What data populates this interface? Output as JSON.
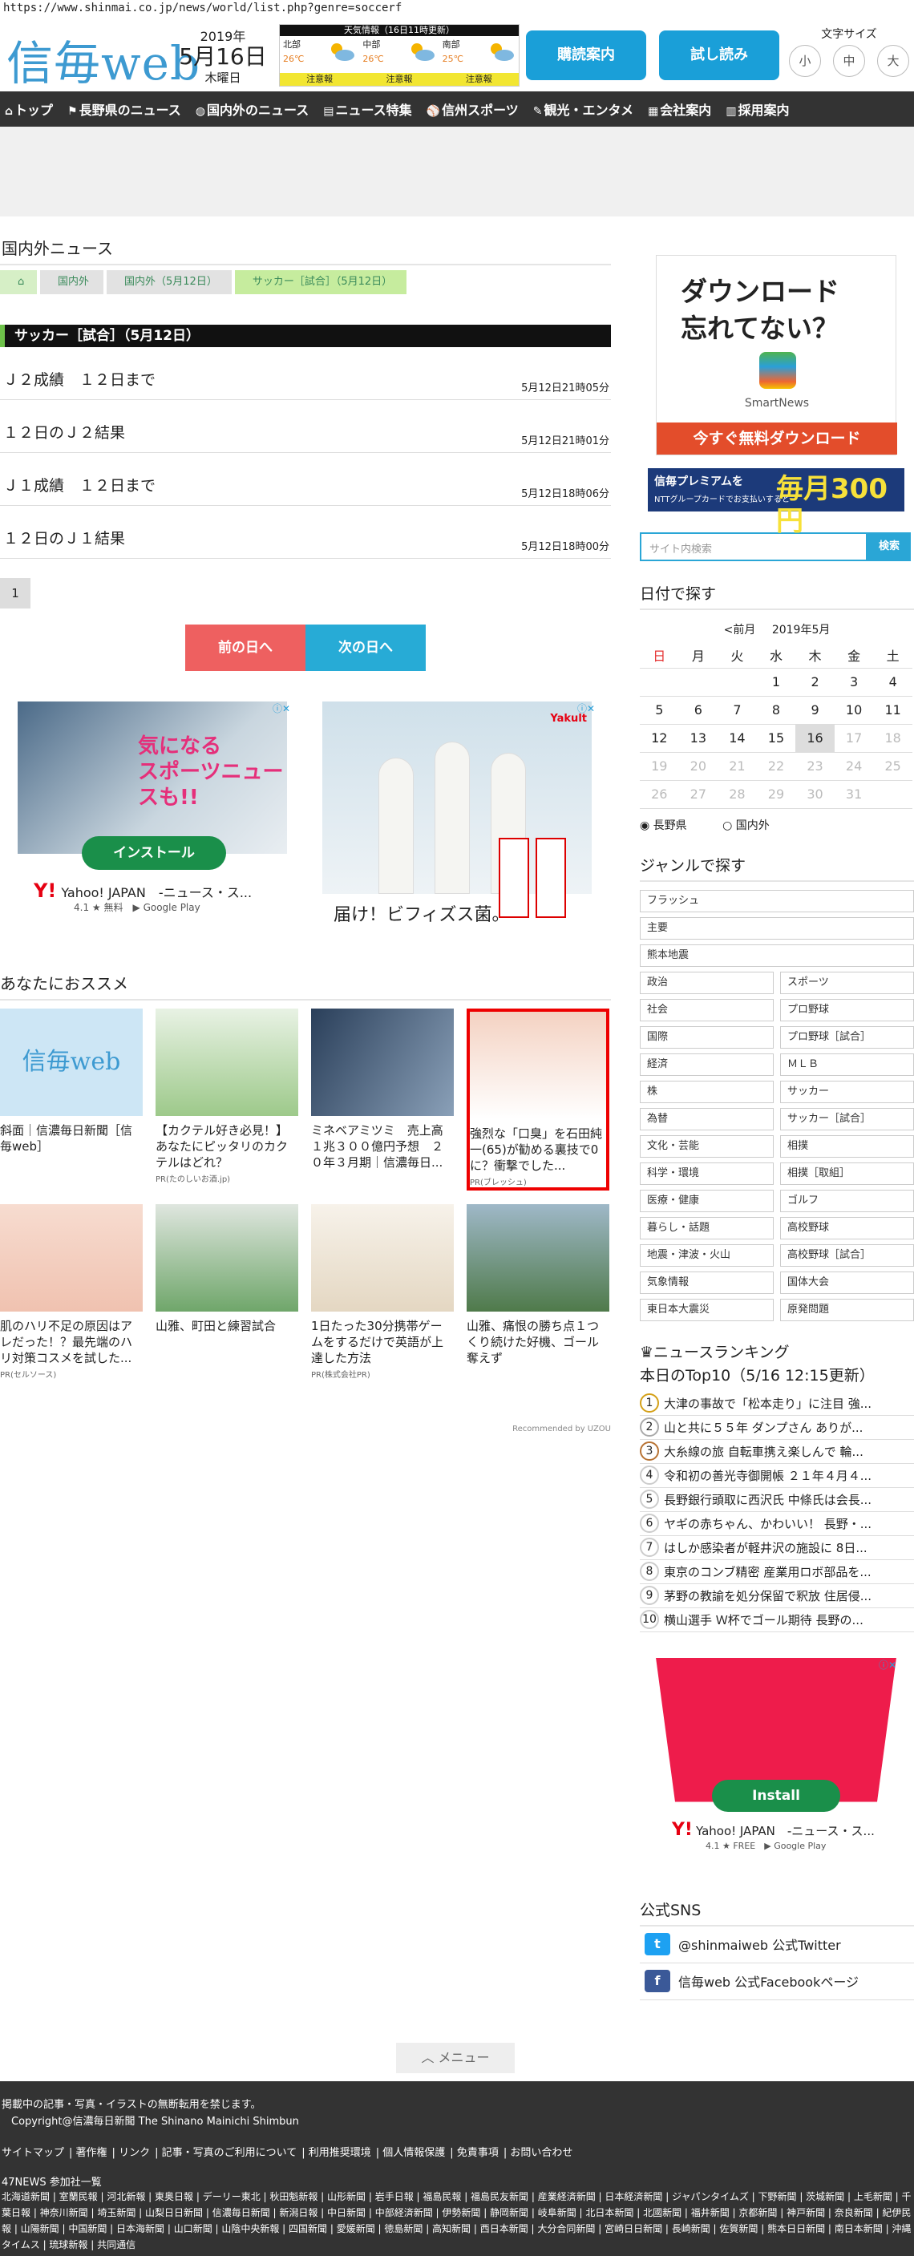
{
  "browser": {
    "url": "https://www.shinmai.co.jp/news/world/list.php?genre=soccerf"
  },
  "header": {
    "logo_text": "信毎web",
    "date": {
      "year": "2019年",
      "month_day": "5月16日",
      "weekday": "木曜日"
    },
    "weather": {
      "title": "天気情報（16日11時更新）",
      "areas": [
        {
          "name": "北部",
          "temp": "26℃",
          "icon": "sun-cloud-icon",
          "warn": "注意報"
        },
        {
          "name": "中部",
          "temp": "26℃",
          "icon": "sun-cloud-icon",
          "warn": "注意報"
        },
        {
          "name": "南部",
          "temp": "25℃",
          "icon": "sun-cloud-icon",
          "warn": "注意報"
        }
      ]
    },
    "subscribe_label": "購読案内",
    "trial_label": "試し読み",
    "font_size": {
      "label": "文字サイズ",
      "small": "小",
      "medium": "中",
      "large": "大"
    }
  },
  "nav": {
    "items": [
      {
        "icon": "home-icon",
        "label": "トップ"
      },
      {
        "icon": "flag-icon",
        "label": "長野県のニュース"
      },
      {
        "icon": "globe-icon",
        "label": "国内外のニュース"
      },
      {
        "icon": "doc-icon",
        "label": "ニュース特集"
      },
      {
        "icon": "sports-icon",
        "label": "信州スポーツ"
      },
      {
        "icon": "camera-icon",
        "label": "観光・エンタメ"
      },
      {
        "icon": "building-icon",
        "label": "会社案内"
      },
      {
        "icon": "people-icon",
        "label": "採用案内"
      }
    ]
  },
  "main": {
    "page_title": "国内外ニュース",
    "breadcrumb": [
      "国内外",
      "国内外（5月12日）",
      "サッカー［試合］（5月12日）"
    ],
    "section_title": "サッカー［試合］（5月12日）",
    "articles": [
      {
        "title": "Ｊ２成績　１２日まで",
        "date": "5月12日21時05分"
      },
      {
        "title": "１２日のＪ２結果",
        "date": "5月12日21時01分"
      },
      {
        "title": "Ｊ１成績　１２日まで",
        "date": "5月12日18時06分"
      },
      {
        "title": "１２日のＪ１結果",
        "date": "5月12日18時00分"
      }
    ],
    "page": "1",
    "prev_day": "前の日へ",
    "next_day": "次の日へ"
  },
  "ads": {
    "ad1": {
      "headline": "気になる\nスポーツニュースも!!",
      "install": "インストール",
      "app": "Yahoo! JAPAN　-ニュース・ス...",
      "rating": "4.1 ★ 無料",
      "store": "Google Play",
      "yj": "Y!"
    },
    "ad2": {
      "brand": "Yakult",
      "text": "届け！ビフィズス菌。"
    },
    "choices": "ⓘ✕"
  },
  "recommend": {
    "title": "あなたにおススメ",
    "cards": [
      {
        "text": "斜面｜信濃毎日新聞［信毎web］",
        "pr": ""
      },
      {
        "text": "【カクテル好き必見！】あなたにピッタリのカクテルはどれ？",
        "pr": "PR(たのしいお酒.jp)"
      },
      {
        "text": "ミネベアミツミ　売上高１兆３００億円予想　２０年３月期｜信濃毎日...",
        "pr": ""
      },
      {
        "text": "強烈な「口臭」を石田純一(65)が勧める裏技で0に？衝撃でした...",
        "pr": "PR(ブレッシュ)"
      },
      {
        "text": "肌のハリ不足の原因はアレだった！？最先端のハリ対策コスメを試した...",
        "pr": "PR(セルソース)"
      },
      {
        "text": "山雅、町田と練習試合",
        "pr": ""
      },
      {
        "text": "1日たった30分携帯ゲームをするだけで英語が上達した方法",
        "pr": "PR(株式会社PR)"
      },
      {
        "text": "山雅、痛恨の勝ち点１つくり続けた好機、ゴール奪えず",
        "pr": ""
      }
    ],
    "by": "Recommended by UZOU"
  },
  "sidebar": {
    "smartnews": {
      "q1": "ダウンロード",
      "q2": "忘れてない？",
      "name": "SmartNews",
      "cta": "今すぐ無料ダウンロード"
    },
    "premium": {
      "a": "信毎プレミアムを",
      "b": "NTTグループカードでお支払いすると",
      "c": "毎月300円"
    },
    "search_placeholder": "サイト内検索",
    "search_button": "検索",
    "date_title": "日付で探す",
    "cal_prev": "<前月",
    "cal_month": "2019年5月",
    "weekdays": [
      "日",
      "月",
      "火",
      "水",
      "木",
      "金",
      "土"
    ],
    "weeks": [
      [
        "",
        "",
        "",
        "1",
        "2",
        "3",
        "4"
      ],
      [
        "5",
        "6",
        "7",
        "8",
        "9",
        "10",
        "11"
      ],
      [
        "12",
        "13",
        "14",
        "15",
        "16",
        "17",
        "18"
      ],
      [
        "19",
        "20",
        "21",
        "22",
        "23",
        "24",
        "25"
      ],
      [
        "26",
        "27",
        "28",
        "29",
        "30",
        "31",
        ""
      ]
    ],
    "radio1": "長野県",
    "radio2": "国内外",
    "genre_title": "ジャンルで探す",
    "genres_full": [
      "フラッシュ",
      "主要",
      "熊本地震"
    ],
    "genres": [
      "政治",
      "スポーツ",
      "社会",
      "プロ野球",
      "国際",
      "プロ野球［試合］",
      "経済",
      "ＭＬＢ",
      "株",
      "サッカー",
      "為替",
      "サッカー［試合］",
      "文化・芸能",
      "相撲",
      "科学・環境",
      "相撲［取組］",
      "医療・健康",
      "ゴルフ",
      "暮らし・話題",
      "高校野球",
      "地震・津波・火山",
      "高校野球［試合］",
      "気象情報",
      "国体大会",
      "東日本大震災",
      "原発問題"
    ],
    "ranking_title": "ニュースランキング",
    "ranking_sub": "本日のTop10（5/16 12:15更新）",
    "ranking": [
      "大津の事故で「松本走り」に注目 強...",
      "山と共に５５年 ダンプさん ありが...",
      "大糸線の旅 自転車携え楽しんで 輪...",
      "令和初の善光寺御開帳 ２１年４月４...",
      "長野銀行頭取に西沢氏 中條氏は会長...",
      "ヤギの赤ちゃん、かわいい！ 長野・...",
      "はしか感染者が軽井沢の施設に 8日...",
      "東京のコンブ精密 産業用ロボ部品を...",
      "茅野の教諭を処分保留で釈放 住居侵...",
      "横山選手 Ｗ杯でゴール期待 長野の..."
    ],
    "yad": {
      "install": "Install",
      "app": "Yahoo! JAPAN　-ニュース・ス...",
      "rating": "4.1 ★ FREE",
      "store": "Google Play"
    },
    "sns_title": "公式SNS",
    "twitter": "@shinmaiweb 公式Twitter",
    "facebook": "信毎web 公式Facebookページ"
  },
  "menu_label": "メニュー",
  "footer": {
    "notice": "掲載中の記事・写真・イラストの無断転用を禁じます。",
    "copyright": "Copyright@信濃毎日新聞 The Shinano Mainichi Shimbun",
    "links": [
      "サイトマップ",
      "著作権",
      "リンク",
      "記事・写真のご利用について",
      "利用推奨環境",
      "個人情報保護",
      "免責事項",
      "お問い合わせ"
    ],
    "partners_title": "47NEWS 参加社一覧",
    "partners": "北海道新聞 | 室蘭民報 | 河北新報 | 東奥日報 | デーリー東北 | 秋田魁新報 | 山形新聞 | 岩手日報 | 福島民報 | 福島民友新聞 | 産業経済新聞 | 日本経済新聞 | ジャパンタイムズ | 下野新聞 | 茨城新聞 | 上毛新聞 | 千葉日報 | 神奈川新聞 | 埼玉新聞 | 山梨日日新聞 | 信濃毎日新聞 | 新潟日報 | 中日新聞 | 中部経済新聞 | 伊勢新聞 | 静岡新聞 | 岐阜新聞 | 北日本新聞 | 北國新聞 | 福井新聞 | 京都新聞 | 神戸新聞 | 奈良新聞 | 紀伊民報 | 山陽新聞 | 中国新聞 | 日本海新聞 | 山口新聞 | 山陰中央新報 | 四国新聞 | 愛媛新聞 | 徳島新聞 | 高知新聞 | 西日本新聞 | 大分合同新聞 | 宮崎日日新聞 | 長崎新聞 | 佐賀新聞 | 熊本日日新聞 | 南日本新聞 | 沖縄タイムス | 琉球新報 | 共同通信"
  },
  "colors": {
    "accent": "#1a9fd8",
    "nav_bg": "#333333",
    "prev": "#ee6060",
    "next": "#27abd6"
  }
}
